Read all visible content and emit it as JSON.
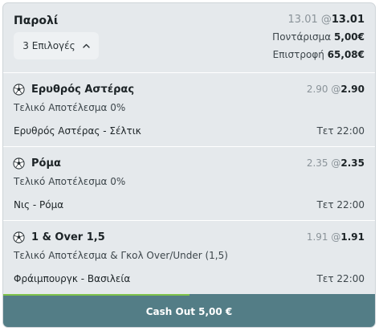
{
  "slip": {
    "title": "Παρολί",
    "selections_button": "3 Επιλογές",
    "odds_original": "13.01",
    "odds_at": "@",
    "odds_current": "13.01",
    "stake_label": "Ποντάρισμα",
    "stake_value": "5,00€",
    "return_label": "Επιστροφή",
    "return_value": "65,08€"
  },
  "selections": [
    {
      "icon": "soccer-ball-icon",
      "name": "Ερυθρός Αστέρας",
      "odds_original": "2.90",
      "odds_at": "@",
      "odds_current": "2.90",
      "market": "Τελικό Αποτέλεσμα 0%",
      "match": "Ερυθρός Αστέρας - Σέλτικ",
      "time": "Τετ 22:00"
    },
    {
      "icon": "soccer-ball-icon",
      "name": "Ρόμα",
      "odds_original": "2.35",
      "odds_at": "@",
      "odds_current": "2.35",
      "market": "Τελικό Αποτέλεσμα 0%",
      "match": "Νις - Ρόμα",
      "time": "Τετ 22:00"
    },
    {
      "icon": "soccer-ball-icon",
      "name": "1 & Over 1,5",
      "odds_original": "1.91",
      "odds_at": "@",
      "odds_current": "1.91",
      "market": "Τελικό Αποτέλεσμα & Γκολ Over/Under (1,5)",
      "match": "Φράιμπουργκ - Βασιλεία",
      "time": "Τετ 22:00"
    }
  ],
  "cashout": {
    "label": "Cash Out 5,00 €",
    "progress_percent": 50
  },
  "colors": {
    "cashout_bg": "#537d86",
    "progress_fill": "#7ec24a",
    "card_bg": "#e5e9ec"
  }
}
